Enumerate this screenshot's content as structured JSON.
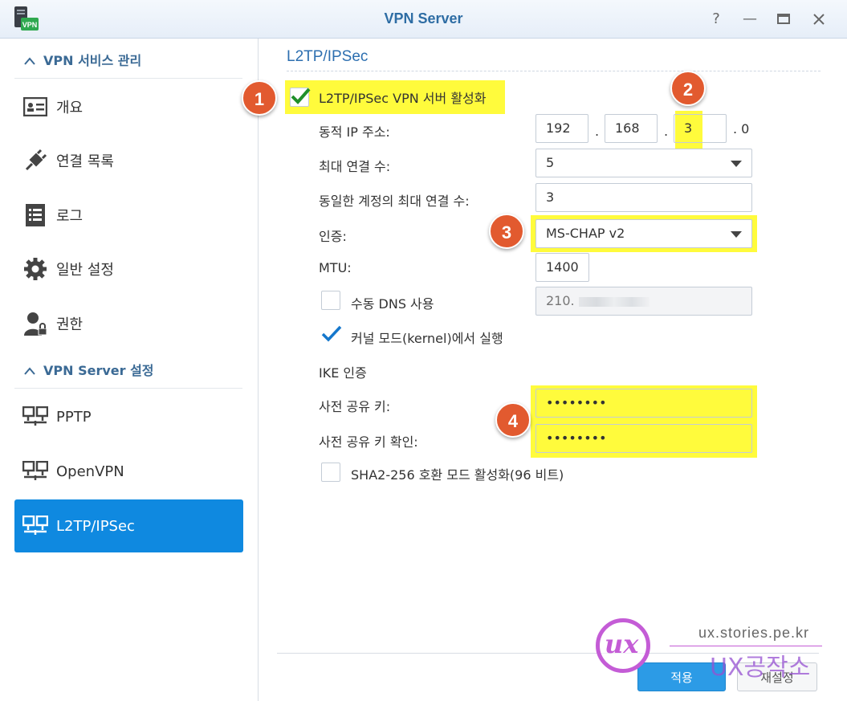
{
  "window": {
    "title": "VPN Server",
    "app_icon_label": "VPN"
  },
  "sidebar": {
    "group1": "VPN 서비스 관리",
    "items1": [
      "개요",
      "연결 목록",
      "로그",
      "일반 설정",
      "권한"
    ],
    "group2": "VPN Server 설정",
    "items2": [
      "PPTP",
      "OpenVPN",
      "L2TP/IPSec"
    ]
  },
  "content": {
    "section_title": "L2TP/IPSec",
    "enable_label": "L2TP/IPSec VPN 서버 활성화",
    "enable_checked": true,
    "dynamic_ip_label": "동적 IP 주소:",
    "ip": [
      "192",
      "168",
      "3"
    ],
    "ip_sep": ".",
    "ip_last": ". 0",
    "max_conn_label": "최대 연결 수:",
    "max_conn_value": "5",
    "max_conn_same_label": "동일한 계정의 최대 연결 수:",
    "max_conn_same_value": "3",
    "auth_label": "인증:",
    "auth_value": "MS-CHAP v2",
    "mtu_label": "MTU:",
    "mtu_value": "1400",
    "manual_dns_label": "수동 DNS 사용",
    "manual_dns_checked": false,
    "dns_value": "210.",
    "kernel_label": "커널 모드(kernel)에서 실행",
    "kernel_checked": true,
    "ike_label": "IKE 인증",
    "psk_label": "사전 공유 키:",
    "psk_value": "••••••••",
    "psk_confirm_label": "사전 공유 키 확인:",
    "psk_confirm_value": "••••••••",
    "sha_label": "SHA2-256 호환 모드 활성화(96 비트)",
    "sha_checked": false
  },
  "badges": [
    "1",
    "2",
    "3",
    "4"
  ],
  "footer": {
    "apply": "적용",
    "reset": "재설정"
  },
  "watermark": {
    "url": "ux.stories.pe.kr",
    "brand": "UX공작소",
    "logo_letters": "ux"
  },
  "colors": {
    "accent": "#0f89e0",
    "highlight": "#fffb3c",
    "badge": "#e25a2f"
  }
}
